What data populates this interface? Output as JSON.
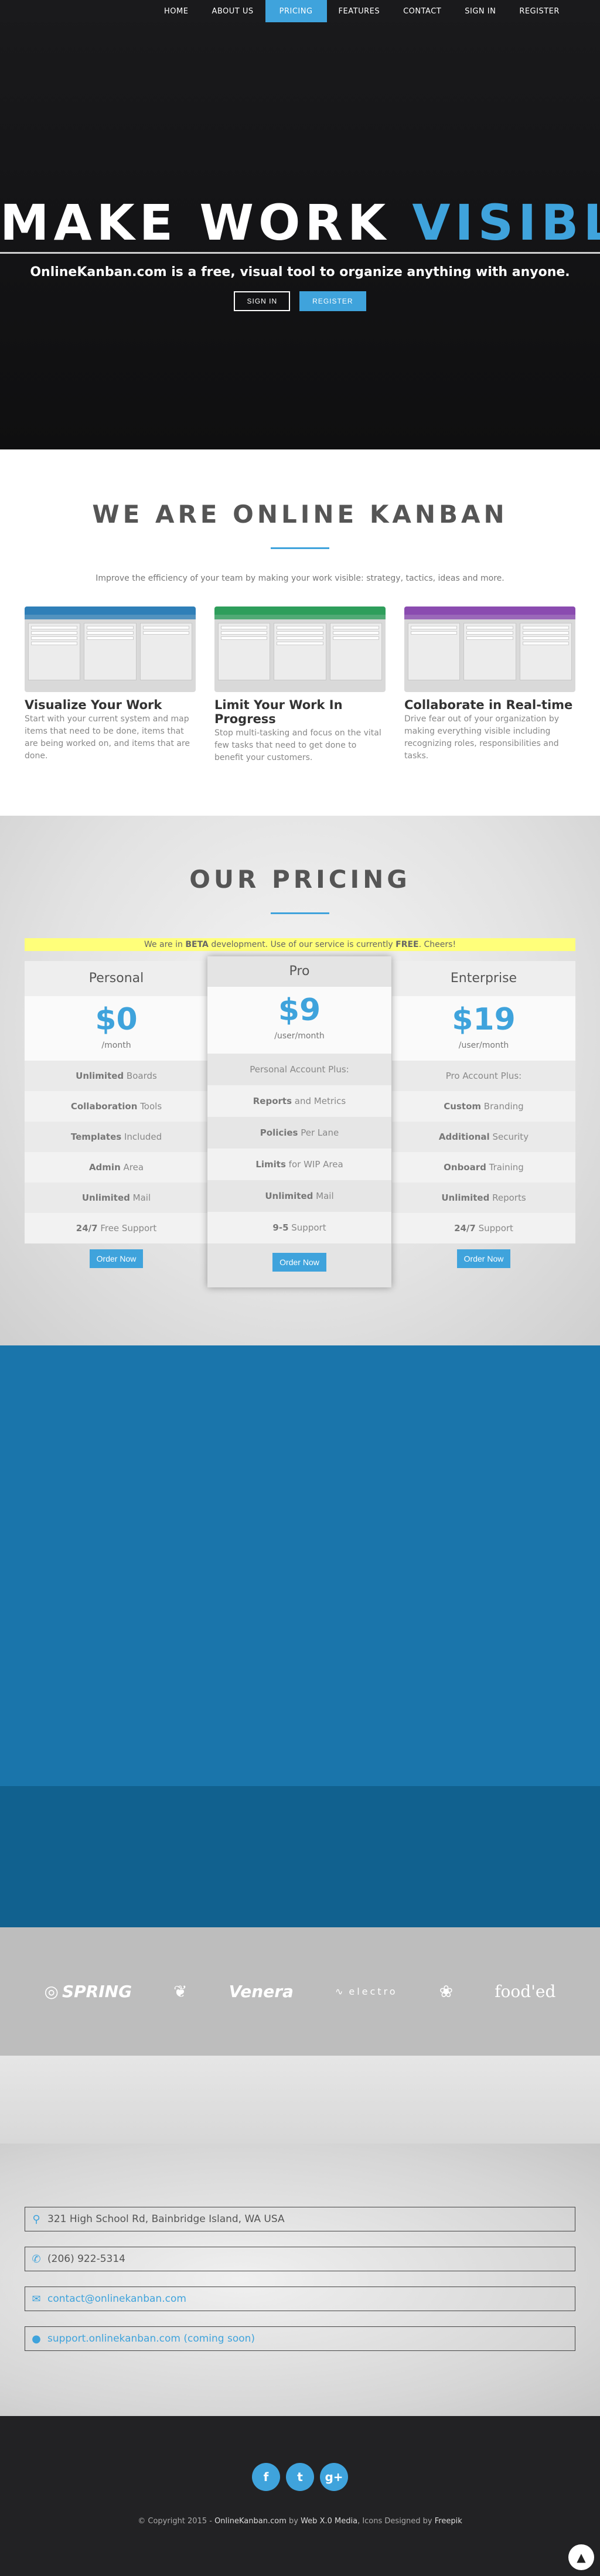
{
  "nav": {
    "items": [
      {
        "label": "HOME"
      },
      {
        "label": "ABOUT US"
      },
      {
        "label": "PRICING"
      },
      {
        "label": "FEATURES"
      },
      {
        "label": "CONTACT"
      },
      {
        "label": "SIGN IN"
      },
      {
        "label": "REGISTER"
      }
    ]
  },
  "hero": {
    "title_part1": "MAKE WORK ",
    "title_part2": "VISIBLE",
    "subtitle": "OnlineKanban.com is a free, visual tool to organize anything with anyone.",
    "signin_label": "SIGN IN",
    "register_label": "REGISTER"
  },
  "about": {
    "title": "WE ARE ONLINE KANBAN",
    "intro": "Improve the efficiency of your team by making your work visible: strategy, tactics, ideas and more.",
    "features": [
      {
        "heading": "Visualize Your Work",
        "text": "Start with your current system and map items that need to be done, items that are being worked on, and items that are done.",
        "color": "#2f7fb8"
      },
      {
        "heading": "Limit Your Work In Progress",
        "text": "Stop multi-tasking and focus on the vital few tasks that need to get done to benefit your customers.",
        "color": "#2e9e5b"
      },
      {
        "heading": "Collaborate in Real-time",
        "text": "Drive fear out of your organization by making everything visible including recognizing roles, responsibilities and tasks.",
        "color": "#8a4bb0"
      }
    ]
  },
  "pricing": {
    "title": "OUR PRICING",
    "beta_pre": "We are in ",
    "beta_bold1": "BETA",
    "beta_mid": " development. Use of our service is currently ",
    "beta_bold2": "FREE",
    "beta_post": ". Cheers!",
    "plans": [
      {
        "name": "Personal",
        "price": "$0",
        "per": "/month",
        "features": [
          {
            "bold": "Unlimited",
            "rest": " Boards"
          },
          {
            "bold": "Collaboration",
            "rest": " Tools"
          },
          {
            "bold": "Templates",
            "rest": " Included"
          },
          {
            "bold": "Admin",
            "rest": " Area"
          },
          {
            "bold": "Unlimited",
            "rest": " Mail"
          },
          {
            "bold": "24/7",
            "rest": " Free Support"
          }
        ],
        "order_label": "Order Now"
      },
      {
        "name": "Pro",
        "price": "$9",
        "per": "/user/month",
        "features": [
          {
            "bold": "",
            "rest": "Personal Account Plus:"
          },
          {
            "bold": "Reports",
            "rest": " and Metrics"
          },
          {
            "bold": "Policies",
            "rest": " Per Lane"
          },
          {
            "bold": "Limits",
            "rest": " for WIP Area"
          },
          {
            "bold": "Unlimited",
            "rest": " Mail"
          },
          {
            "bold": "9-5",
            "rest": " Support"
          }
        ],
        "order_label": "Order Now"
      },
      {
        "name": "Enterprise",
        "price": "$19",
        "per": "/user/month",
        "features": [
          {
            "bold": "",
            "rest": "Pro Account Plus:"
          },
          {
            "bold": "Custom",
            "rest": " Branding"
          },
          {
            "bold": "Additional",
            "rest": " Security"
          },
          {
            "bold": "Onboard",
            "rest": " Training"
          },
          {
            "bold": "Unlimited",
            "rest": " Reports"
          },
          {
            "bold": "24/7",
            "rest": " Support"
          }
        ],
        "order_label": "Order Now"
      }
    ]
  },
  "clients": {
    "logos": [
      "SPRING",
      "Venera",
      "electro",
      "food'ed"
    ]
  },
  "contact": {
    "address": "321 High School Rd, Bainbridge Island, WA USA",
    "phone": "(206) 922-5314",
    "email": "contact@onlinekanban.com",
    "support": "support.onlinekanban.com (coming soon)"
  },
  "footer": {
    "social": [
      "f",
      "t",
      "g+"
    ],
    "copy_pre": "© Copyright 2015 - ",
    "copy_site": "OnlineKanban.com",
    "copy_by": " by ",
    "copy_agency": "Web X.0 Media",
    "copy_icons": ", Icons Designed by ",
    "copy_freepik": "Freepik"
  },
  "colors": {
    "accent": "#3fa3dc",
    "beta": "#ffff7a",
    "band1": "#1a75ab",
    "band2": "#11618f"
  }
}
